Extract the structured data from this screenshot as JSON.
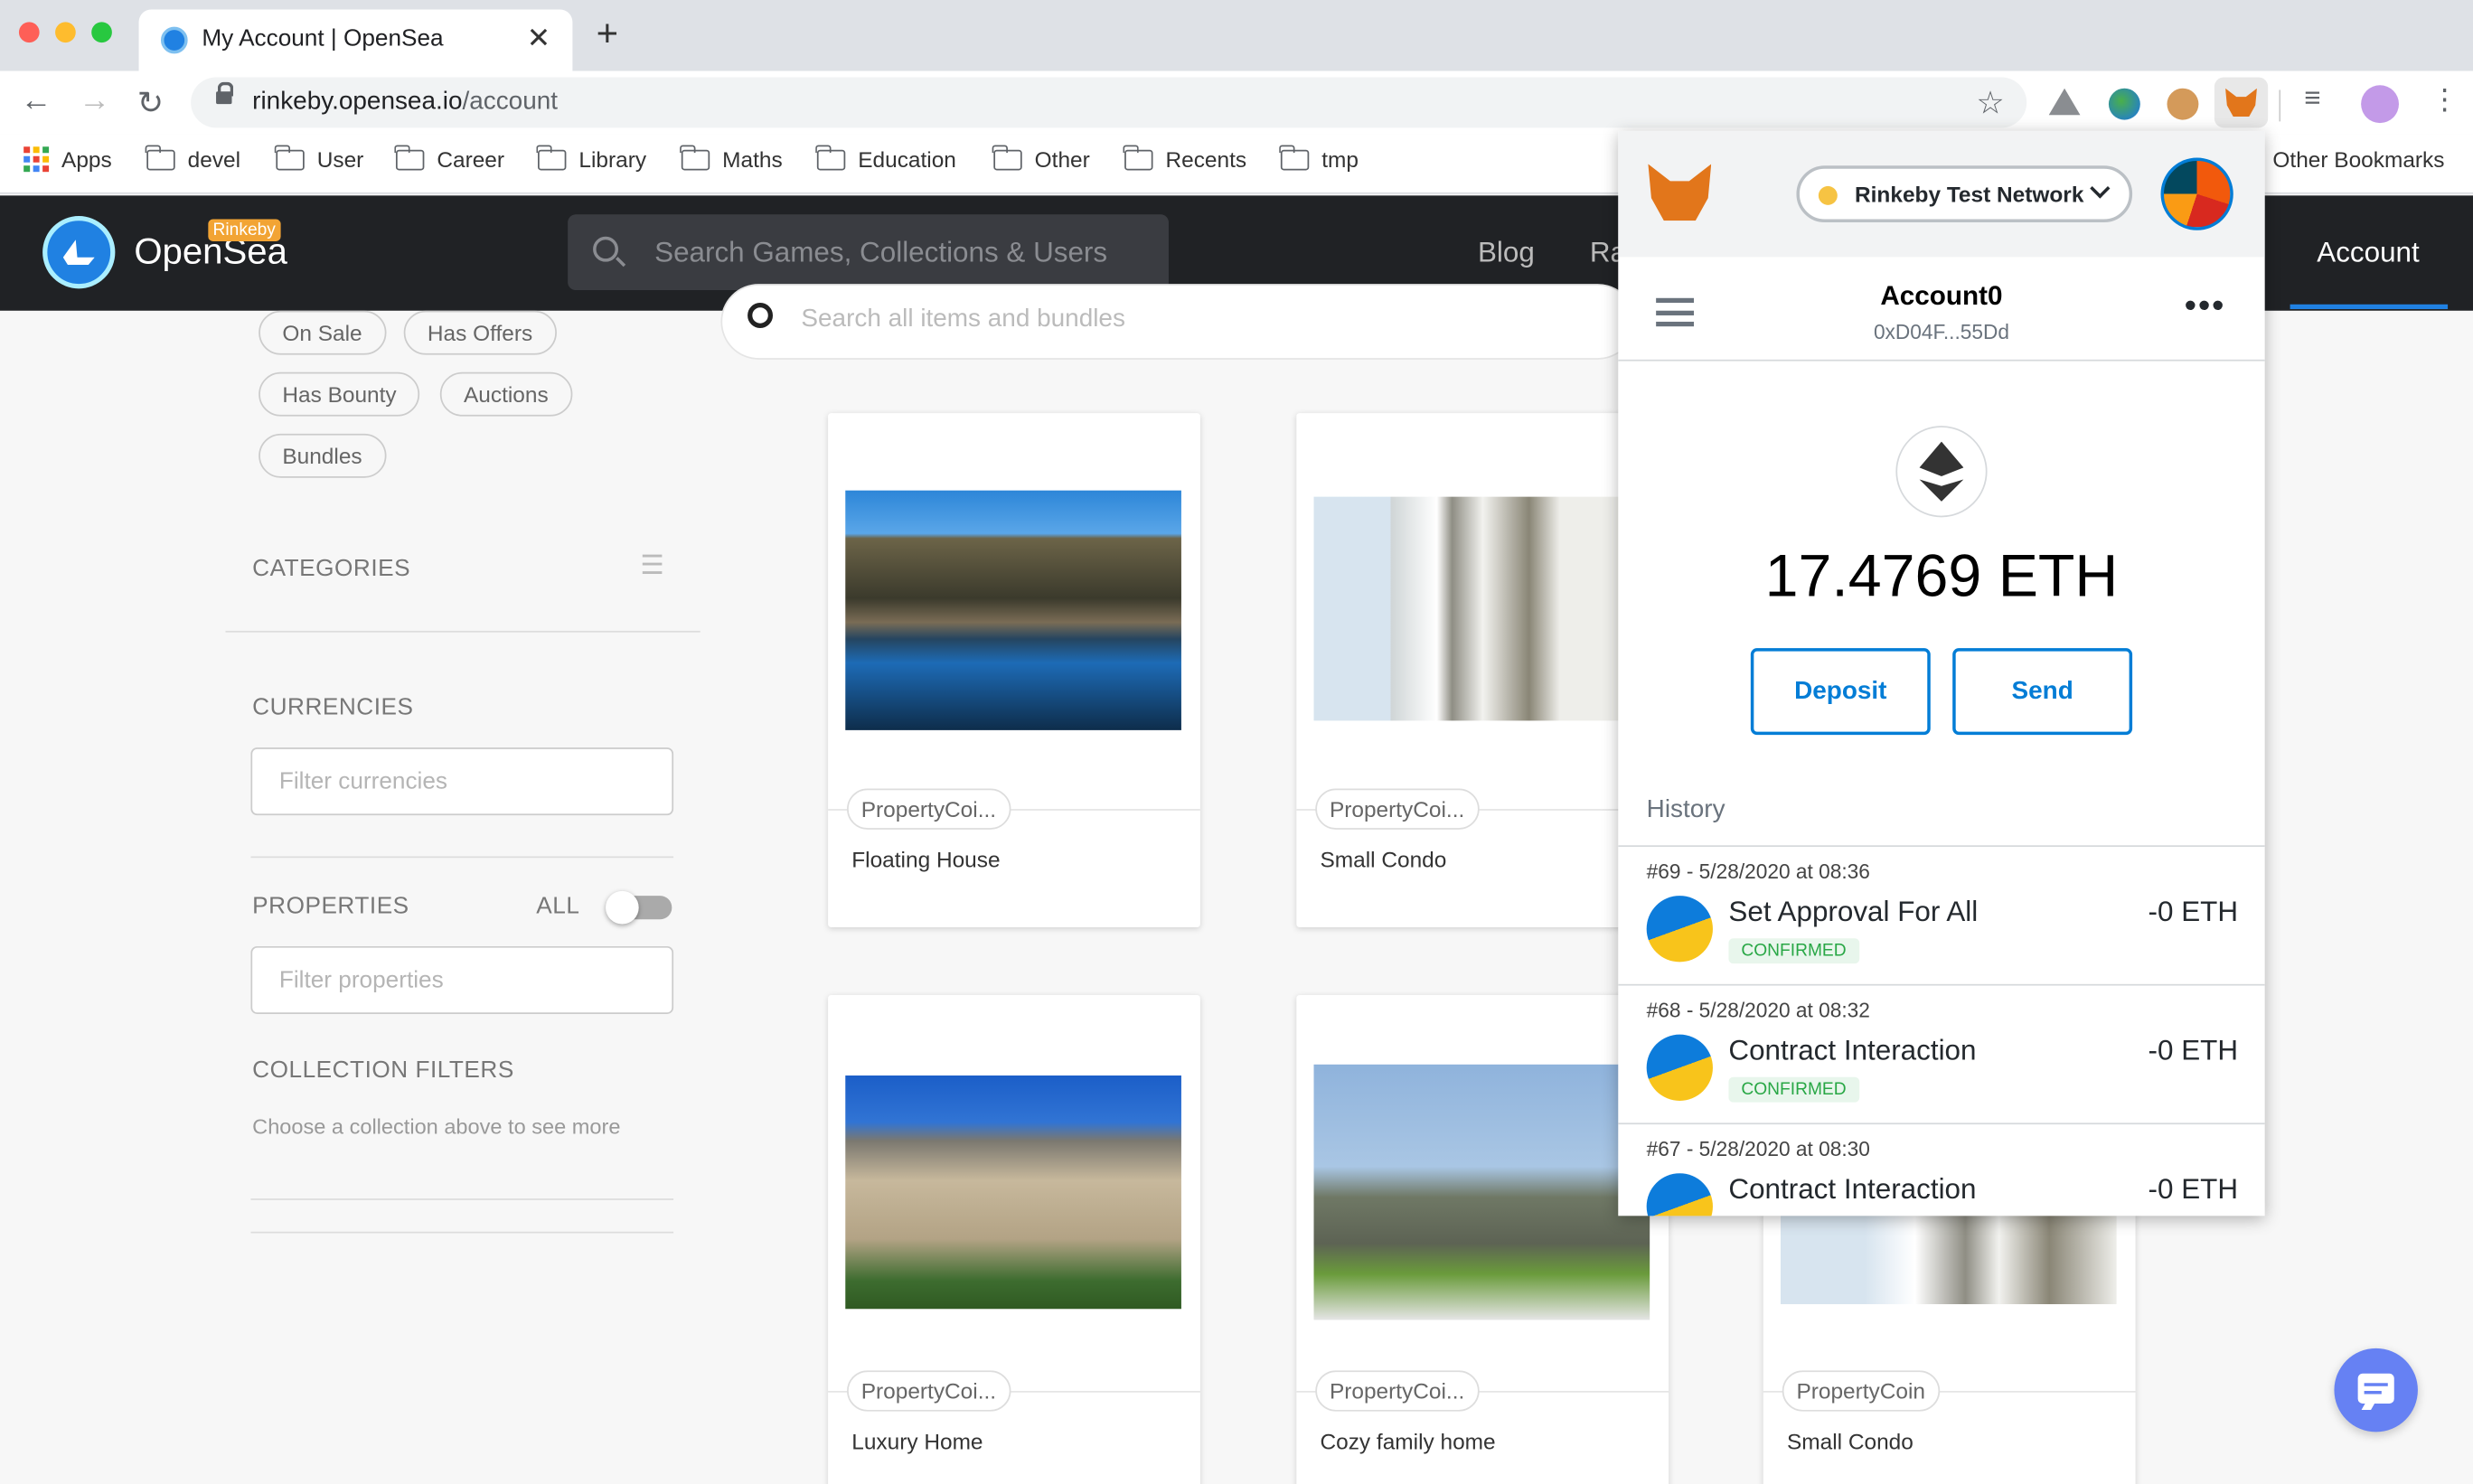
{
  "browser": {
    "tab_title": "My Account | OpenSea",
    "url_host": "rinkeby.opensea.io",
    "url_path": "/account",
    "bookmarks": [
      "Apps",
      "devel",
      "User",
      "Career",
      "Library",
      "Maths",
      "Education",
      "Other",
      "Recents",
      "tmp"
    ],
    "other_bookmarks": "Other Bookmarks"
  },
  "header": {
    "title": "OpenSea",
    "badge": "Rinkeby",
    "search_placeholder": "Search Games, Collections & Users",
    "nav_blog": "Blog",
    "nav_ra": "Ra",
    "nav_account": "Account"
  },
  "filters": {
    "pills": [
      "On Sale",
      "Has Offers",
      "Has Bounty",
      "Auctions",
      "Bundles"
    ],
    "categories": "CATEGORIES",
    "currencies": "CURRENCIES",
    "currency_placeholder": "Filter currencies",
    "properties": "PROPERTIES",
    "all": "ALL",
    "properties_placeholder": "Filter properties",
    "collection_filters": "COLLECTION FILTERS",
    "collection_hint": "Choose a collection above to see more"
  },
  "items_search_placeholder": "Search all items and bundles",
  "cards": [
    {
      "chip": "PropertyCoi...",
      "name": "Floating House"
    },
    {
      "chip": "PropertyCoi...",
      "name": "Small Condo"
    },
    {
      "chip": "PropertyCoi...",
      "name": "Luxury Home"
    },
    {
      "chip": "PropertyCoi...",
      "name": "Cozy family home"
    },
    {
      "chip": "PropertyCoin",
      "name": "Small Condo"
    }
  ],
  "metamask": {
    "network": "Rinkeby Test Network",
    "account_name": "Account0",
    "address": "0xD04F...55Dd",
    "balance": "17.4769 ETH",
    "deposit": "Deposit",
    "send": "Send",
    "history_label": "History",
    "transactions": [
      {
        "date": "#69 - 5/28/2020 at 08:36",
        "title": "Set Approval For All",
        "amount": "-0 ETH",
        "status": "CONFIRMED"
      },
      {
        "date": "#68 - 5/28/2020 at 08:32",
        "title": "Contract Interaction",
        "amount": "-0 ETH",
        "status": "CONFIRMED"
      },
      {
        "date": "#67 - 5/28/2020 at 08:30",
        "title": "Contract Interaction",
        "amount": "-0 ETH",
        "status": ""
      }
    ]
  },
  "colors": {
    "brand": "#2081e2",
    "header_bg": "#202225",
    "metamask_blue": "#037dd6",
    "confirmed": "#28a745"
  }
}
